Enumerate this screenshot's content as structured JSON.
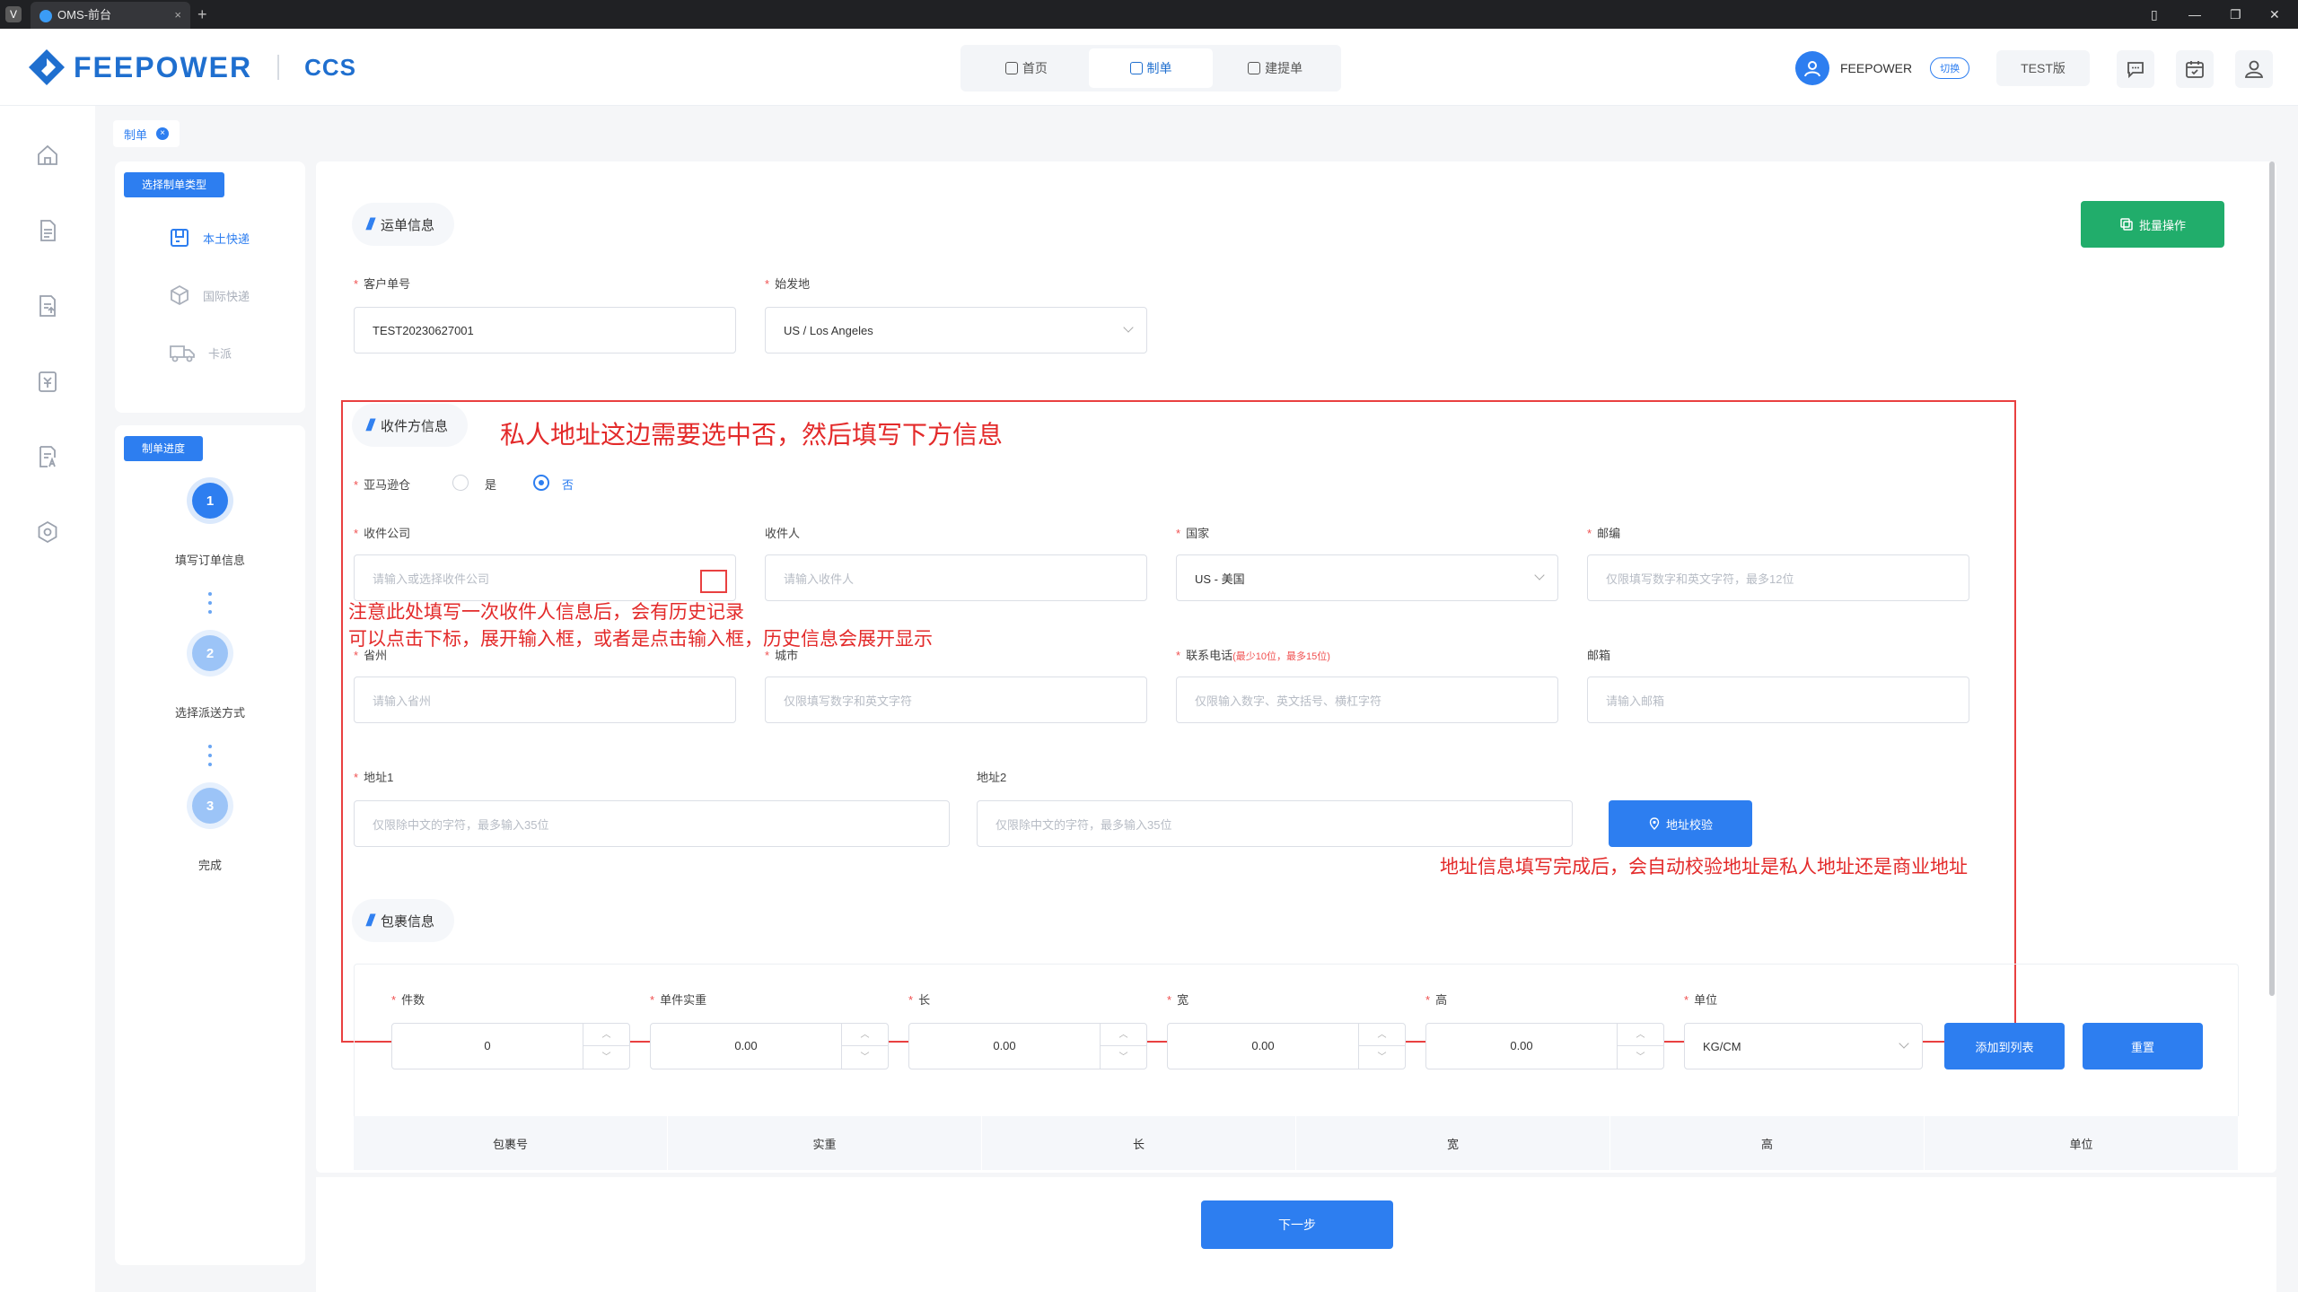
{
  "window": {
    "tab_title": "OMS-前台",
    "icon_letter": "V",
    "tab_close": "×",
    "new_tab": "+"
  },
  "window_controls": {
    "pin": "▯",
    "minimize": "—",
    "restore": "❐",
    "close": "✕"
  },
  "brand": {
    "name": "FEEPOWER",
    "product": "CCS",
    "color": "#1f6fcf"
  },
  "topnav": [
    {
      "label": "首页",
      "icon": "grid-icon"
    },
    {
      "label": "制单",
      "icon": "user-doc-icon",
      "active": true
    },
    {
      "label": "建提单",
      "icon": "add-doc-icon"
    }
  ],
  "user": {
    "name": "FEEPOWER",
    "switch_label": "切换",
    "env_label": "TEST版"
  },
  "header_icons": [
    "message-icon",
    "calendar-icon",
    "user-icon"
  ],
  "sidebar_icons": [
    "home-icon",
    "document-icon",
    "upload-icon",
    "invoice-icon",
    "report-icon",
    "settings-icon"
  ],
  "breadcrumb": {
    "label": "制单",
    "close": "×"
  },
  "left_panel": {
    "type_header": "选择制单类型",
    "types": [
      {
        "label": "本土快递",
        "icon": "local-express-icon",
        "active": true
      },
      {
        "label": "国际快递",
        "icon": "box-icon",
        "active": false
      },
      {
        "label": "卡派",
        "icon": "truck-icon",
        "active": false
      }
    ],
    "progress_header": "制单进度",
    "steps": [
      {
        "num": "1",
        "label": "填写订单信息",
        "active": true
      },
      {
        "num": "2",
        "label": "选择派送方式",
        "active": false
      },
      {
        "num": "3",
        "label": "完成",
        "active": false
      }
    ]
  },
  "waybill": {
    "title": "运单信息",
    "batch_button": "批量操作",
    "customer_no_label": "客户单号",
    "customer_no_value": "TEST20230627001",
    "origin_label": "始发地",
    "origin_value": "US / Los Angeles"
  },
  "receiver": {
    "title": "收件方信息",
    "amazon_label": "亚马逊仓",
    "yes": "是",
    "no": "否",
    "selected": "否",
    "company_label": "收件公司",
    "company_placeholder": "请输入或选择收件公司",
    "person_label": "收件人",
    "person_placeholder": "请输入收件人",
    "country_label": "国家",
    "country_value": "US - 美国",
    "zip_label": "邮编",
    "zip_placeholder": "仅限填写数字和英文字符，最多12位",
    "state_label": "省州",
    "state_placeholder": "请输入省州",
    "city_label": "城市",
    "city_placeholder": "仅限填写数字和英文字符",
    "phone_label": "联系电话",
    "phone_hint": "(最少10位，最多15位)",
    "phone_placeholder": "仅限输入数字、英文括号、横杠字符",
    "email_label": "邮箱",
    "email_placeholder": "请输入邮箱",
    "addr1_label": "地址1",
    "addr1_placeholder": "仅限除中文的字符，最多输入35位",
    "addr2_label": "地址2",
    "addr2_placeholder": "仅限除中文的字符，最多输入35位",
    "verify_button": "地址校验"
  },
  "annotations": {
    "title": "私人地址这边需要选中否，然后填写下方信息",
    "hint_line1": "注意此处填写一次收件人信息后，会有历史记录",
    "hint_line2": "可以点击下标，展开输入框，或者是点击输入框，历史信息会展开显示",
    "verify_note": "地址信息填写完成后，会自动校验地址是私人地址还是商业地址"
  },
  "package": {
    "title": "包裹信息",
    "fields": [
      {
        "label": "件数",
        "value": "0"
      },
      {
        "label": "单件实重",
        "value": "0.00"
      },
      {
        "label": "长",
        "value": "0.00"
      },
      {
        "label": "宽",
        "value": "0.00"
      },
      {
        "label": "高",
        "value": "0.00"
      }
    ],
    "unit_label": "单位",
    "unit_value": "KG/CM",
    "add_button": "添加到列表",
    "reset_button": "重置",
    "columns": [
      "包裹号",
      "实重",
      "长",
      "宽",
      "高",
      "单位"
    ]
  },
  "footer": {
    "next_button": "下一步"
  },
  "colors": {
    "primary": "#2d7ef0",
    "green": "#21ad6b",
    "annotation": "#e32a2a"
  }
}
